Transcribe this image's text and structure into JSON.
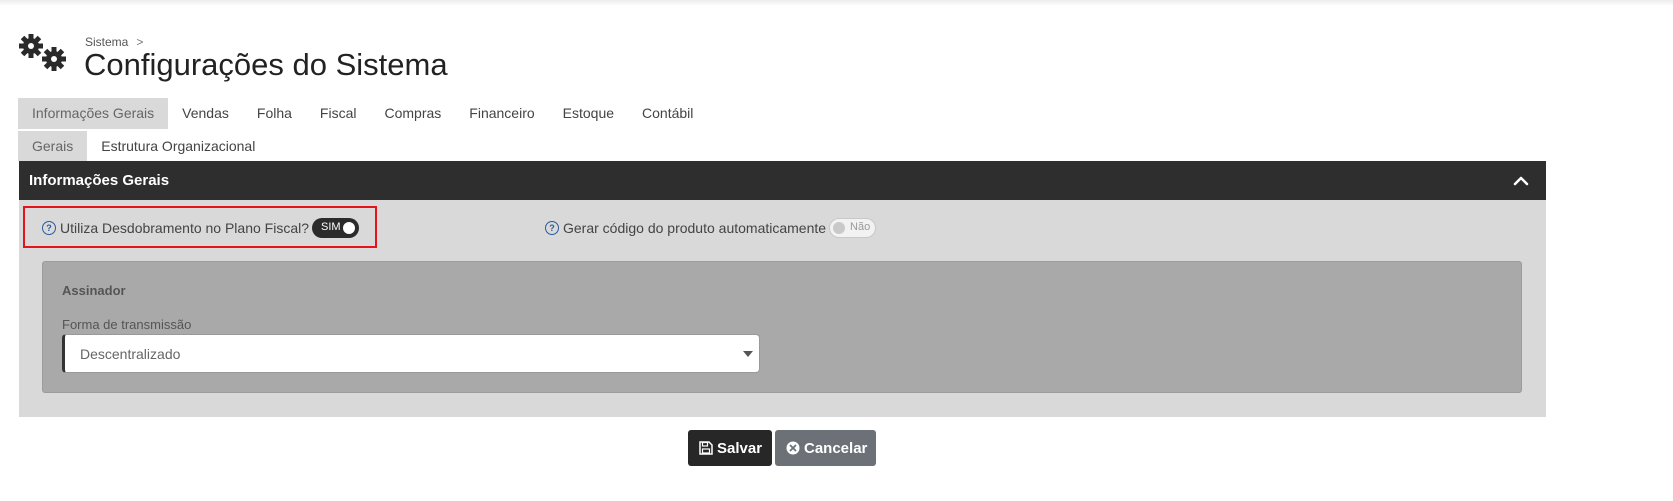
{
  "breadcrumb": {
    "parent": "Sistema",
    "separator": ">"
  },
  "page": {
    "title": "Configurações do Sistema",
    "icon": "gears-icon"
  },
  "tabs": [
    {
      "label": "Informações Gerais",
      "active": true
    },
    {
      "label": "Vendas"
    },
    {
      "label": "Folha"
    },
    {
      "label": "Fiscal"
    },
    {
      "label": "Compras"
    },
    {
      "label": "Financeiro"
    },
    {
      "label": "Estoque"
    },
    {
      "label": "Contábil"
    }
  ],
  "subtabs": [
    {
      "label": "Gerais",
      "active": true
    },
    {
      "label": "Estrutura Organizacional"
    }
  ],
  "panel": {
    "title": "Informações Gerais",
    "collapse_icon": "chevron-up-icon",
    "options": {
      "desdobramento": {
        "label": "Utiliza Desdobramento no Plano Fiscal?",
        "toggle_label": "SIM",
        "on": true
      },
      "gerar_codigo": {
        "label": "Gerar código do produto automaticamente",
        "toggle_label": "Não",
        "on": false
      }
    },
    "assinador": {
      "title": "Assinador",
      "field_label": "Forma de transmissão",
      "selected": "Descentralizado"
    }
  },
  "buttons": {
    "save": "Salvar",
    "cancel": "Cancelar"
  },
  "colors": {
    "highlight": "#e3141b",
    "header_dark": "#2e2e2e",
    "save_bg": "#272727",
    "cancel_bg": "#6b7177",
    "help_icon": "#2b5a9c"
  }
}
